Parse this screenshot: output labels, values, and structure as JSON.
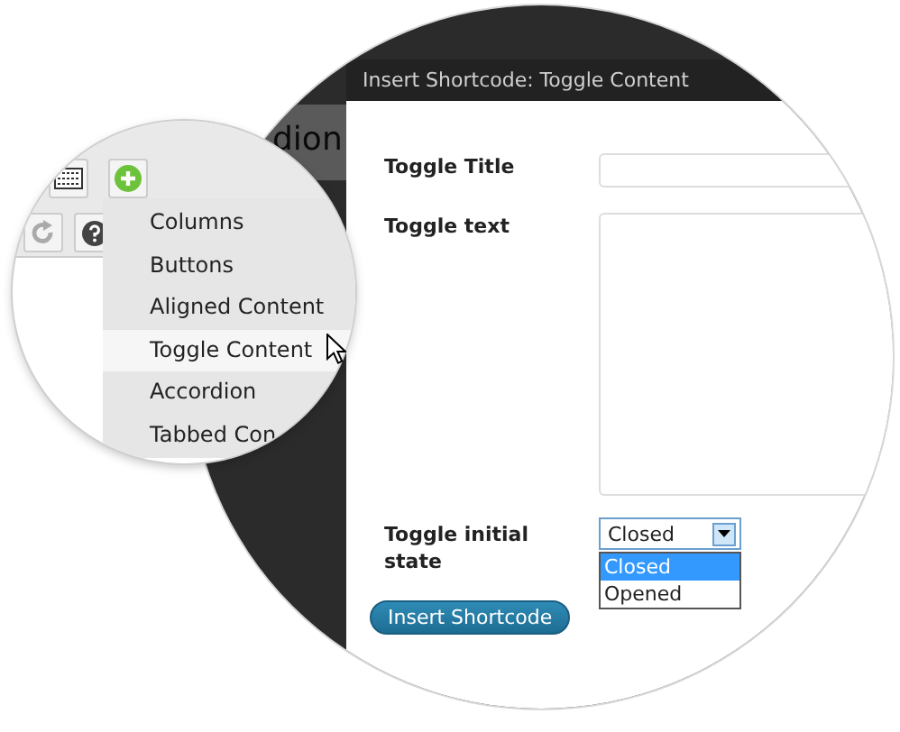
{
  "background_heading": "dion",
  "dialog": {
    "title": "Insert Shortcode: Toggle Content",
    "fields": [
      {
        "kind": "text",
        "label": "Toggle Title"
      },
      {
        "kind": "textarea",
        "label": "Toggle text"
      },
      {
        "kind": "select",
        "label": "Toggle initial state",
        "value": "Closed",
        "expanded": true,
        "options": [
          {
            "label": "Closed",
            "selected": true
          },
          {
            "label": "Opened",
            "selected": false
          }
        ]
      }
    ],
    "submit": "Insert Shortcode"
  },
  "shortcode_menu": {
    "items": [
      {
        "label": "Columns",
        "selected": false
      },
      {
        "label": "Buttons",
        "selected": false
      },
      {
        "label": "Aligned Content",
        "selected": false
      },
      {
        "label": "Toggle Content",
        "selected": true
      },
      {
        "label": "Accordion",
        "selected": false
      },
      {
        "label": "Tabbed Con",
        "selected": false
      }
    ]
  }
}
